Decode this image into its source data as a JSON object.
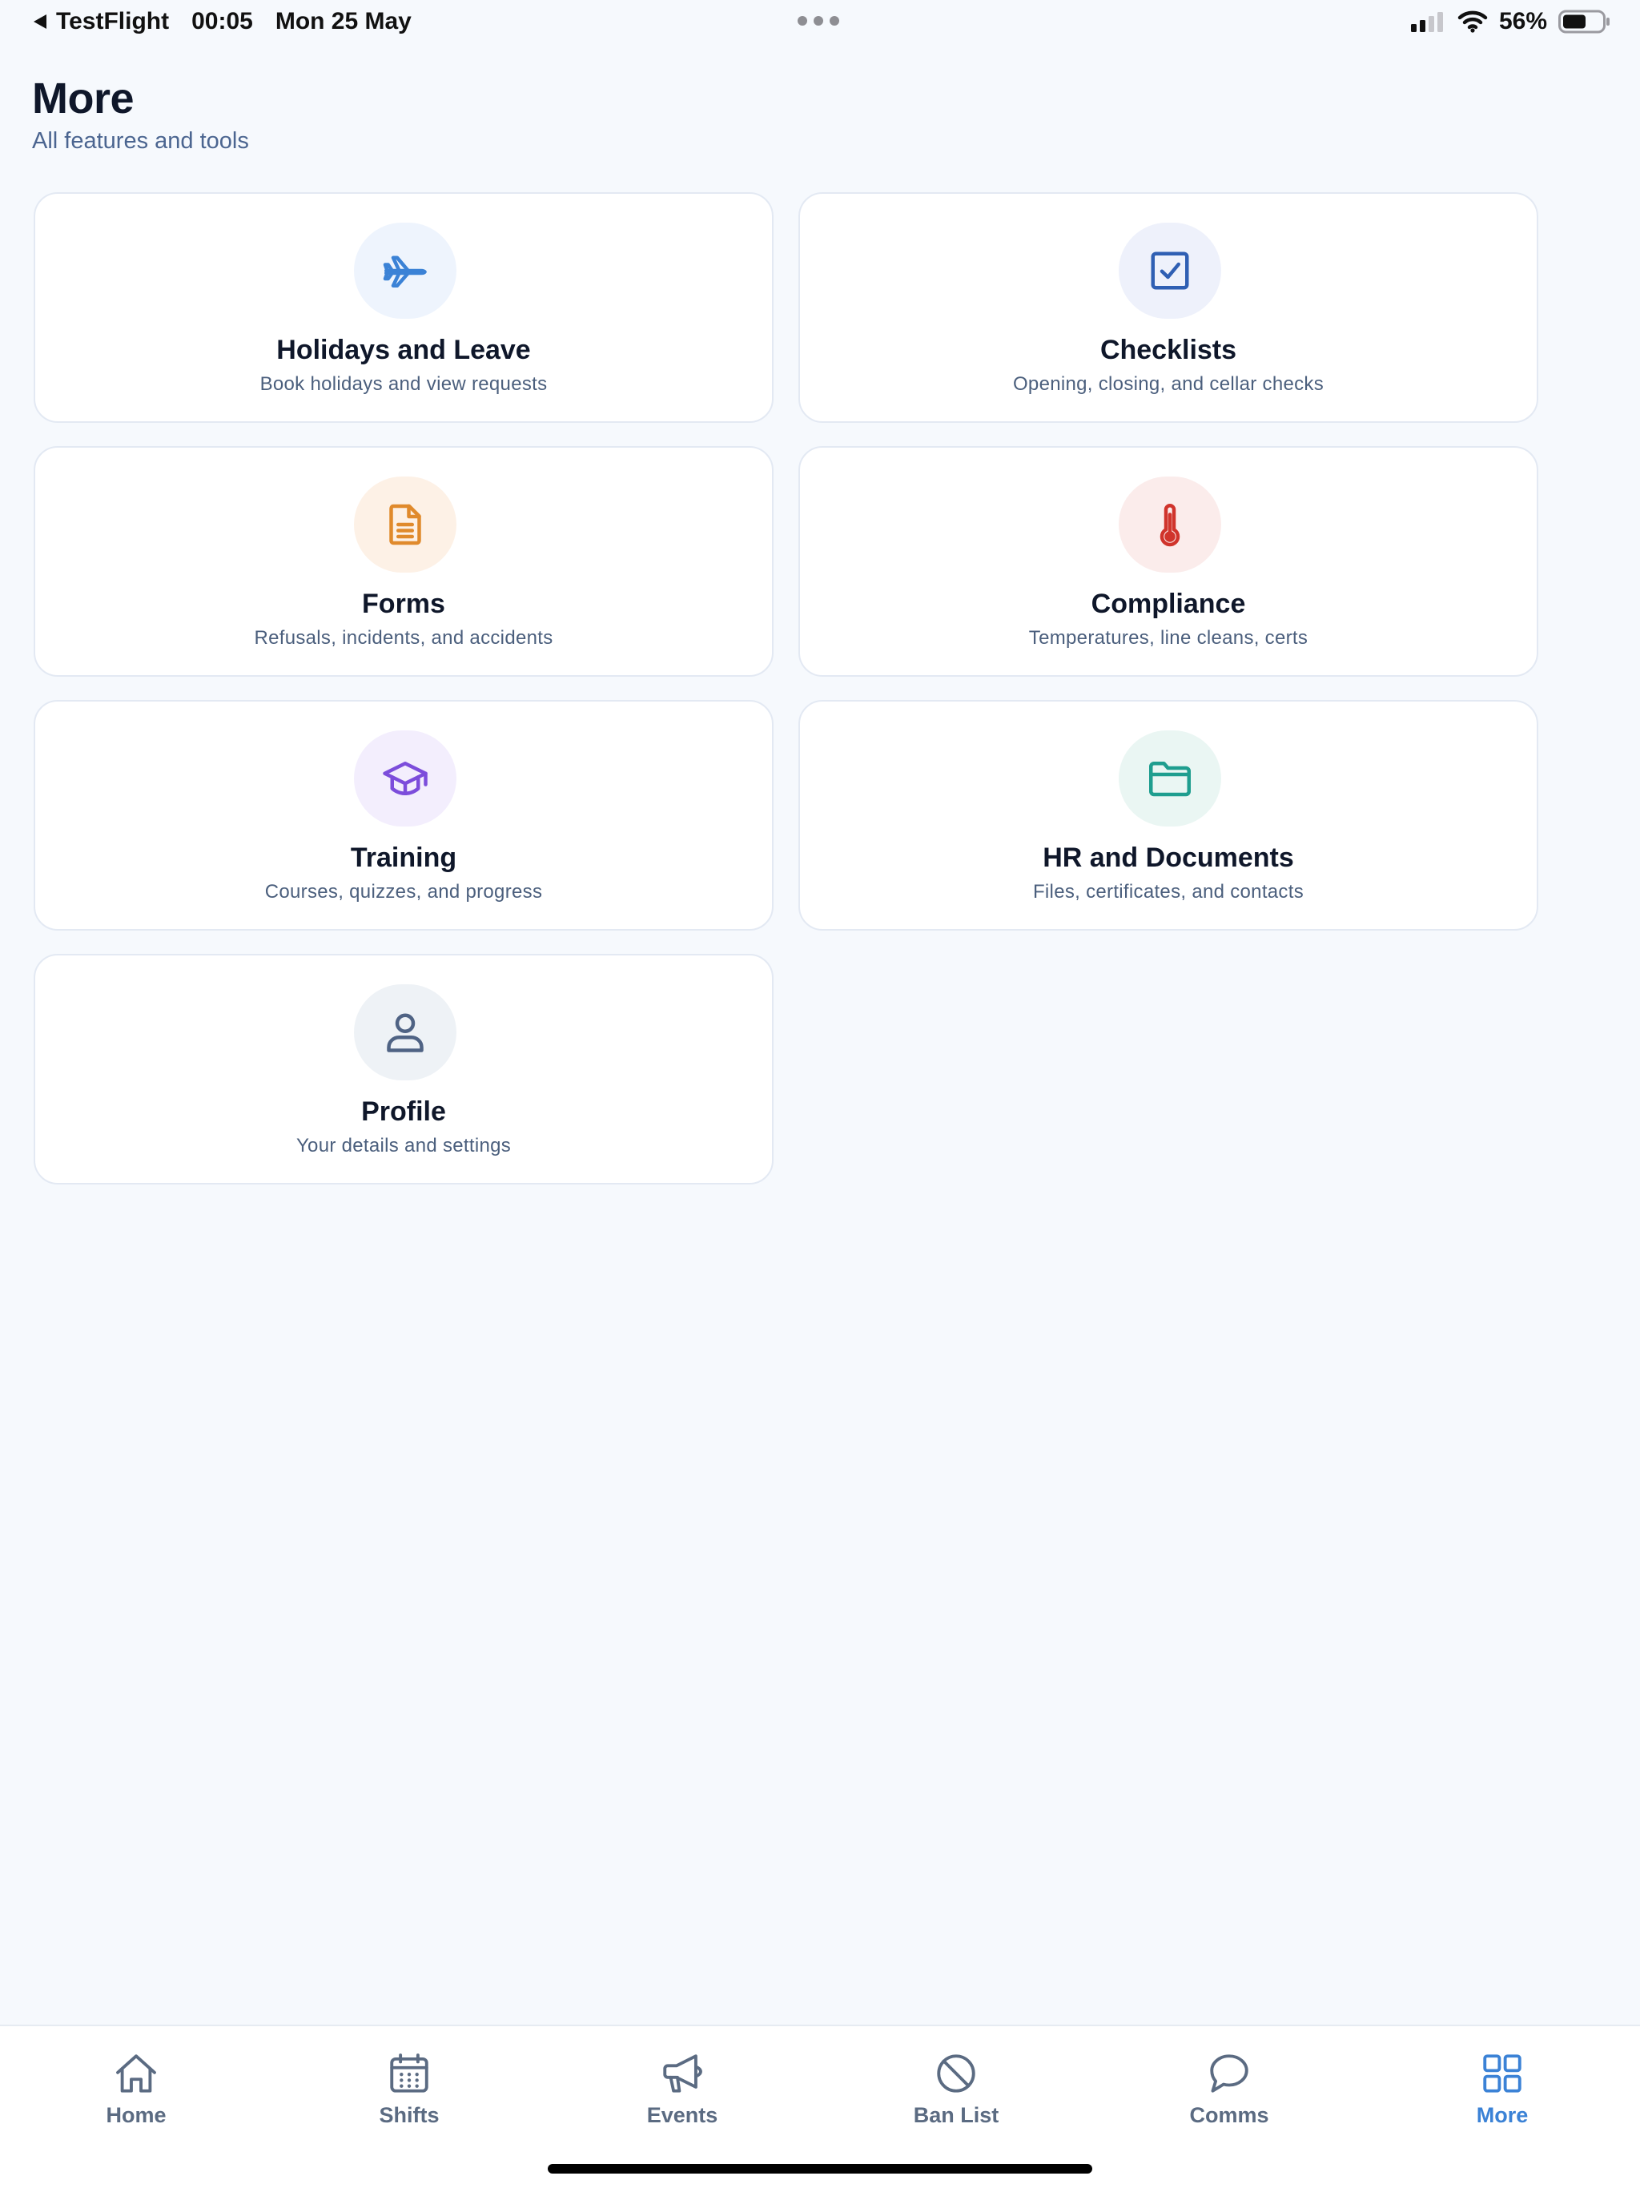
{
  "status_bar": {
    "back_app": "TestFlight",
    "time": "00:05",
    "date": "Mon 25 May",
    "battery": "56%"
  },
  "header": {
    "title": "More",
    "subtitle": "All features and tools"
  },
  "cards": [
    {
      "title": "Holidays and Leave",
      "description": "Book holidays and view requests",
      "icon": "airplane-icon",
      "accent": "#3b82d6",
      "bg": "#eef4fd"
    },
    {
      "title": "Checklists",
      "description": "Opening, closing, and cellar checks",
      "icon": "checkbox-icon",
      "accent": "#2f5fb3",
      "bg": "#eef1fb"
    },
    {
      "title": "Forms",
      "description": "Refusals, incidents, and accidents",
      "icon": "document-icon",
      "accent": "#e08a2c",
      "bg": "#fdf1e6"
    },
    {
      "title": "Compliance",
      "description": "Temperatures, line cleans, certs",
      "icon": "thermometer-icon",
      "accent": "#d0342c",
      "bg": "#fbeceb"
    },
    {
      "title": "Training",
      "description": "Courses, quizzes, and progress",
      "icon": "graduation-cap-icon",
      "accent": "#7c4ddb",
      "bg": "#f3eefd"
    },
    {
      "title": "HR and Documents",
      "description": "Files, certificates, and contacts",
      "icon": "folder-icon",
      "accent": "#1f9e8f",
      "bg": "#eaf6f3"
    },
    {
      "title": "Profile",
      "description": "Your details and settings",
      "icon": "user-icon",
      "accent": "#4f6384",
      "bg": "#eef2f6"
    }
  ],
  "tabs": [
    {
      "label": "Home",
      "icon": "home-icon"
    },
    {
      "label": "Shifts",
      "icon": "calendar-icon"
    },
    {
      "label": "Events",
      "icon": "megaphone-icon"
    },
    {
      "label": "Ban List",
      "icon": "ban-icon"
    },
    {
      "label": "Comms",
      "icon": "chat-bubble-icon"
    },
    {
      "label": "More",
      "icon": "grid-icon",
      "active": true
    }
  ],
  "colors": {
    "background": "#f6f9fd",
    "active_tab": "#3b82d6",
    "inactive_tab": "#5b6b82"
  }
}
